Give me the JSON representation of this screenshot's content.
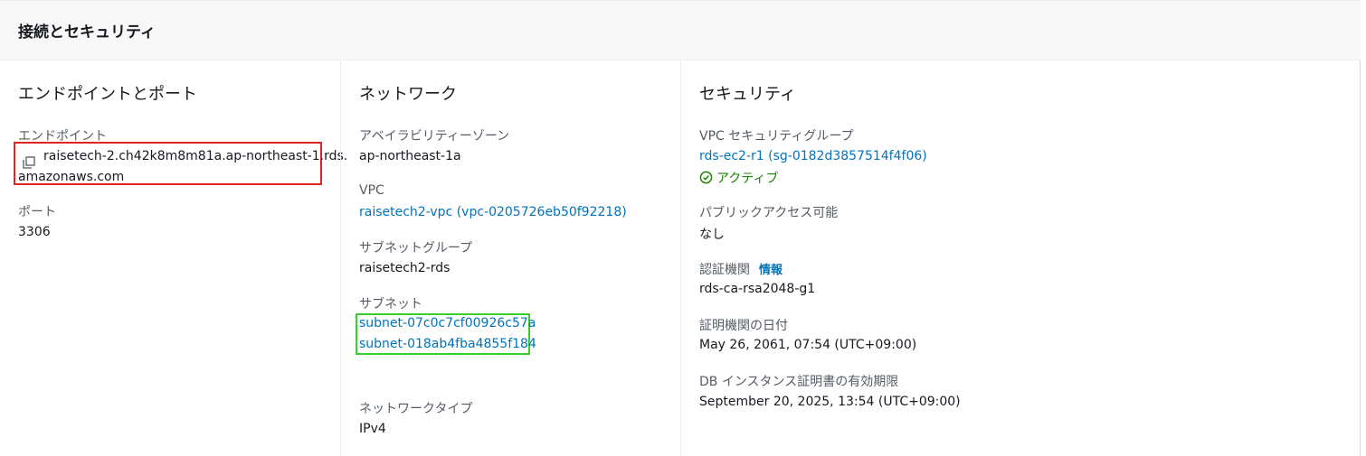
{
  "header": {
    "title": "接続とセキュリティ"
  },
  "endpoints": {
    "section_title": "エンドポイントとポート",
    "endpoint_label": "エンドポイント",
    "endpoint_value_line1": "raisetech-2.ch42k8m8m81a.ap-northeast-1.rds.",
    "endpoint_value_line2": "amazonaws.com",
    "copy_icon": "copy-icon",
    "port_label": "ポート",
    "port_value": "3306"
  },
  "network": {
    "section_title": "ネットワーク",
    "az_label": "アベイラビリティーゾーン",
    "az_value": "ap-northeast-1a",
    "vpc_label": "VPC",
    "vpc_value": "raisetech2-vpc (vpc-0205726eb50f92218)",
    "subnet_group_label": "サブネットグループ",
    "subnet_group_value": "raisetech2-rds",
    "subnets_label": "サブネット",
    "subnets": [
      "subnet-07c0c7cf00926c57a",
      "subnet-018ab4fba4855f184"
    ],
    "network_type_label": "ネットワークタイプ",
    "network_type_value": "IPv4"
  },
  "security": {
    "section_title": "セキュリティ",
    "sg_label": "VPC セキュリティグループ",
    "sg_value": "rds-ec2-r1 (sg-0182d3857514f4f06)",
    "sg_status": "アクティブ",
    "public_access_label": "パブリックアクセス可能",
    "public_access_value": "なし",
    "ca_label": "認証機関",
    "ca_info_link": "情報",
    "ca_value": "rds-ca-rsa2048-g1",
    "ca_date_label": "証明機関の日付",
    "ca_date_value": "May 26, 2061, 07:54 (UTC+09:00)",
    "cert_expiry_label": "DB インスタンス証明書の有効期限",
    "cert_expiry_value": "September 20, 2025, 13:54 (UTC+09:00)"
  },
  "colors": {
    "link": "#0073bb",
    "success": "#1d8102",
    "endpoint_highlight": "#e02424",
    "subnet_highlight": "#35d129"
  }
}
